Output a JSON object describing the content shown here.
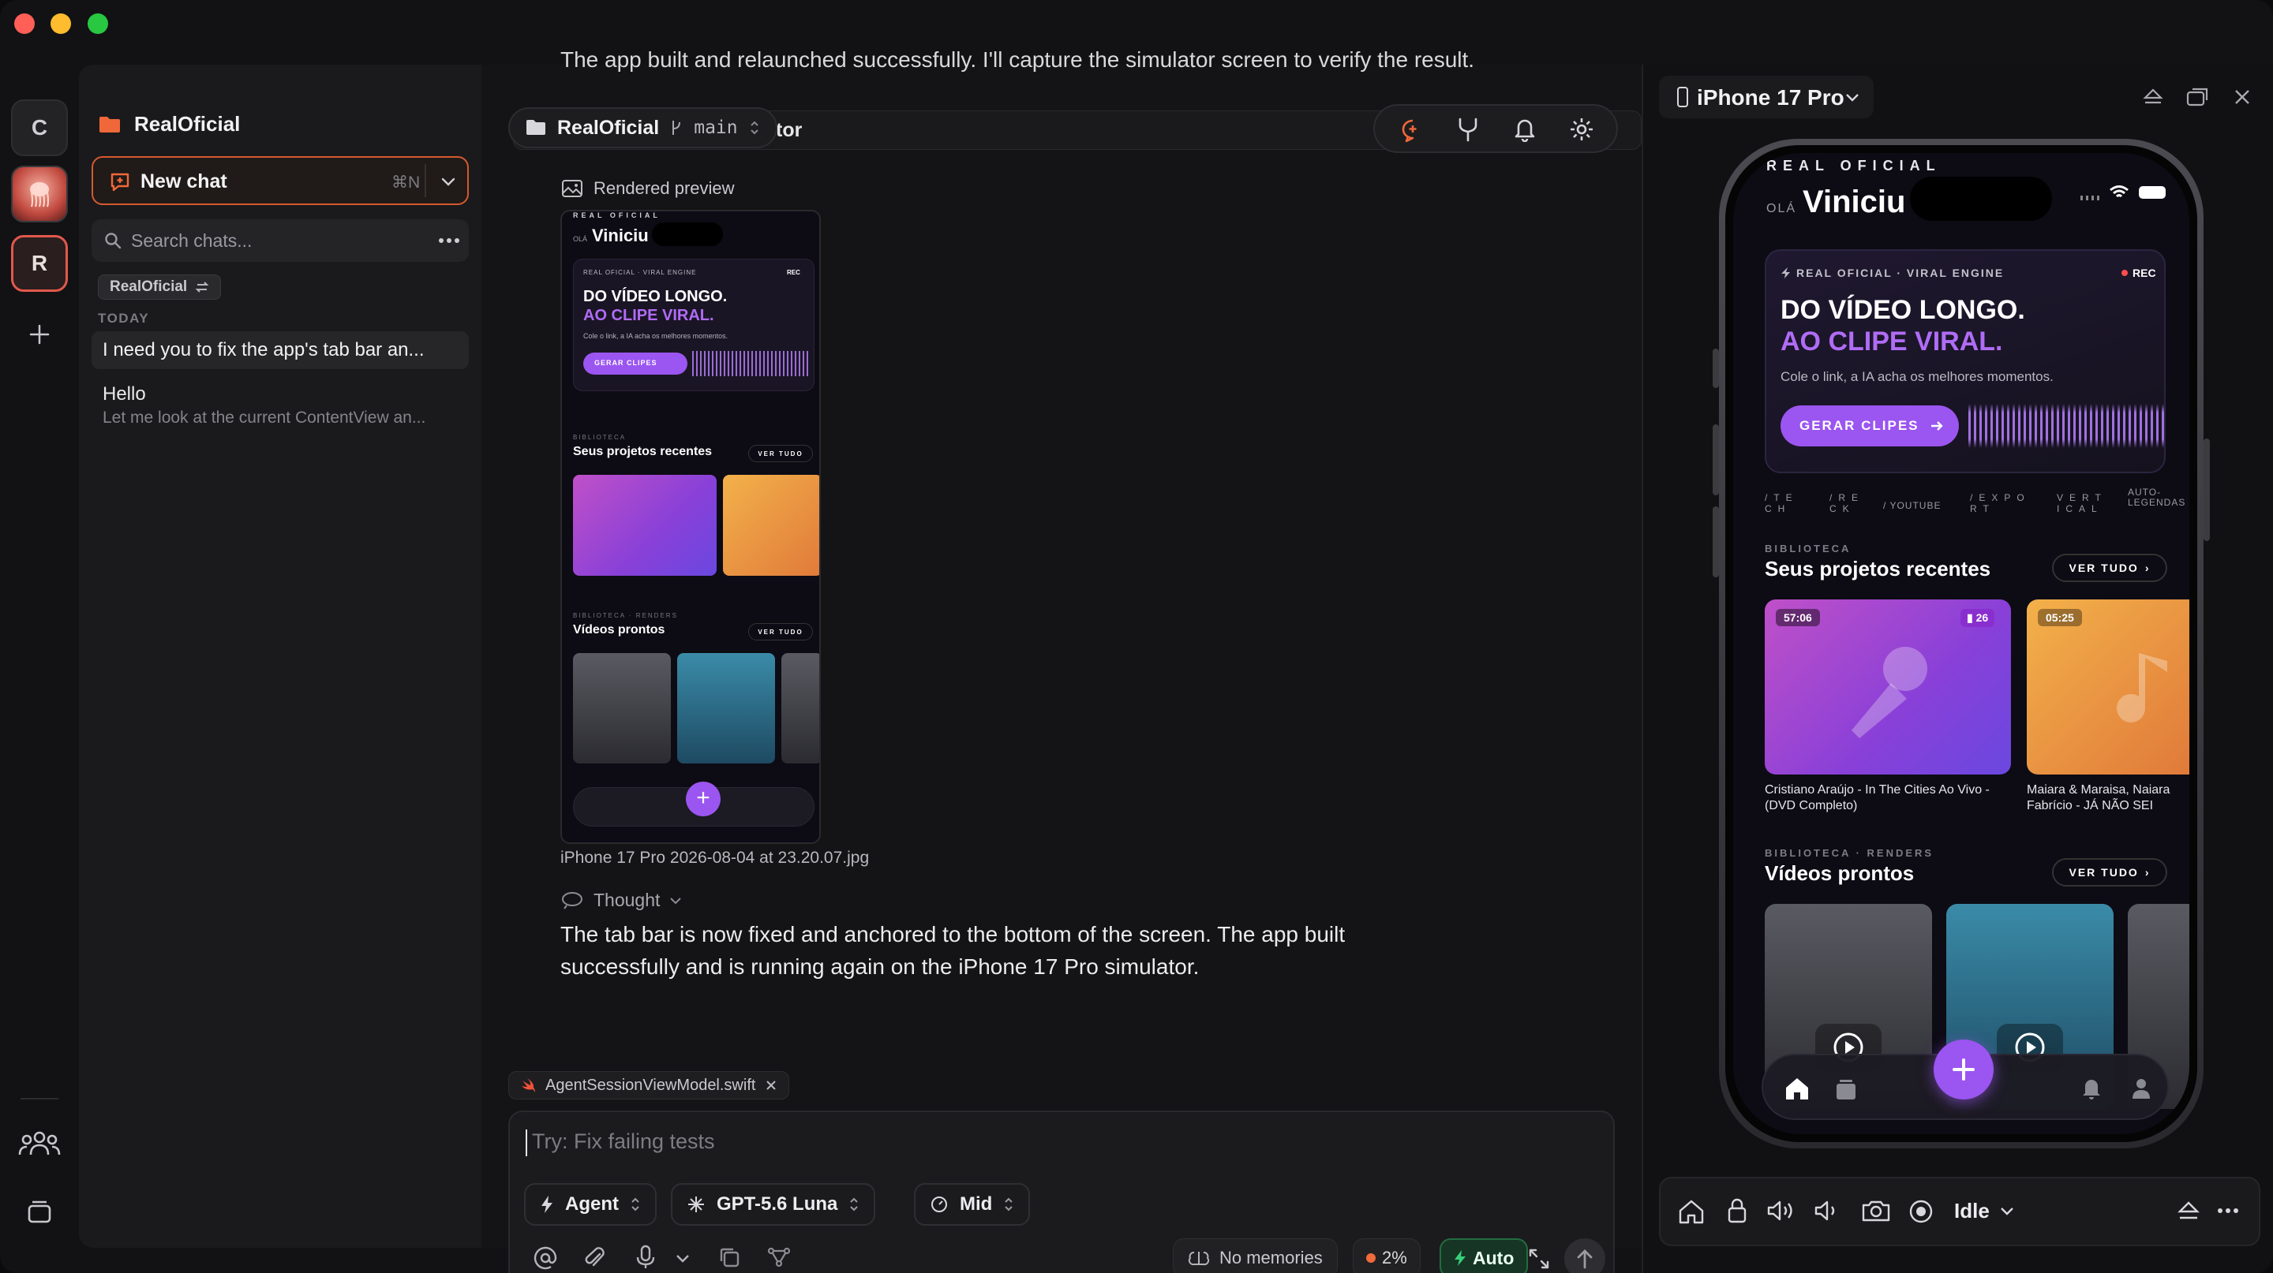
{
  "rail": {
    "c_label": "C",
    "r_label": "R",
    "add_icon": "plus-icon"
  },
  "sidebar": {
    "project": "RealOficial",
    "new_chat": "New chat",
    "new_chat_shortcut": "⌘N",
    "search_placeholder": "Search chats...",
    "filter_tag": "RealOficial",
    "section_today": "TODAY",
    "chats": [
      {
        "title": "I need you to fix the app's tab bar an...",
        "subtitle": ""
      },
      {
        "title": "Hello",
        "subtitle": "Let me look at the current ContentView an..."
      }
    ]
  },
  "main": {
    "top_cut_text": "The app built and relaunched successfully. I'll capture the simulator screen to verify the result.",
    "toolbar_project": "RealOficial",
    "toolbar_branch": "main",
    "tool_partial": "tor",
    "rendered_preview_label": "Rendered preview",
    "image_caption": "iPhone 17 Pro 2026-08-04 at 23.20.07.jpg",
    "thought_label": "Thought",
    "message": "The tab bar is now fixed and anchored to the bottom of the screen. The app built successfully and is running again on the iPhone 17 Pro simulator.",
    "attachment": "AgentSessionViewModel.swift",
    "input_placeholder": "Try: Fix failing tests",
    "mode": "Agent",
    "model": "GPT-5.6 Luna",
    "effort": "Mid",
    "memories": "No memories",
    "context_pct": "2%",
    "auto": "Auto"
  },
  "device": {
    "name": "iPhone 17 Pro",
    "status": "Idle"
  },
  "app": {
    "brand": "REAL OFICIAL",
    "greeting_prefix": "OLÁ",
    "greeting_name": "Viniciu",
    "engine_label": "REAL OFICIAL · VIRAL ENGINE",
    "rec": "REC",
    "headline1": "DO VÍDEO LONGO.",
    "headline2": "AO CLIPE VIRAL.",
    "tagline": "Cole o link, a IA acha os melhores momentos.",
    "cta": "GERAR CLIPES",
    "features": [
      "/TE CH",
      "/RE CK",
      "/ YOUTUBE",
      "/EXPO RT",
      "VERT ICAL",
      "AUTO-LEGENDAS"
    ],
    "lib_overline": "BIBLIOTECA",
    "lib_title": "Seus projetos recentes",
    "see_all": "VER TUDO",
    "projects": [
      {
        "duration": "57:06",
        "badge": "26",
        "title": "Cristiano Araújo - In The Cities Ao Vivo - (DVD Completo)"
      },
      {
        "duration": "05:25",
        "badge": "",
        "title": "Maiara & Maraisa, Naiara Fabrício - JÁ NÃO SEI"
      }
    ],
    "renders_overline": "BIBLIOTECA · RENDERS",
    "renders_title": "Vídeos prontos"
  },
  "colors": {
    "accent": "#a259f5",
    "orange": "#f06a3a",
    "green": "#2fbf6f",
    "rec": "#ff4d4d"
  }
}
